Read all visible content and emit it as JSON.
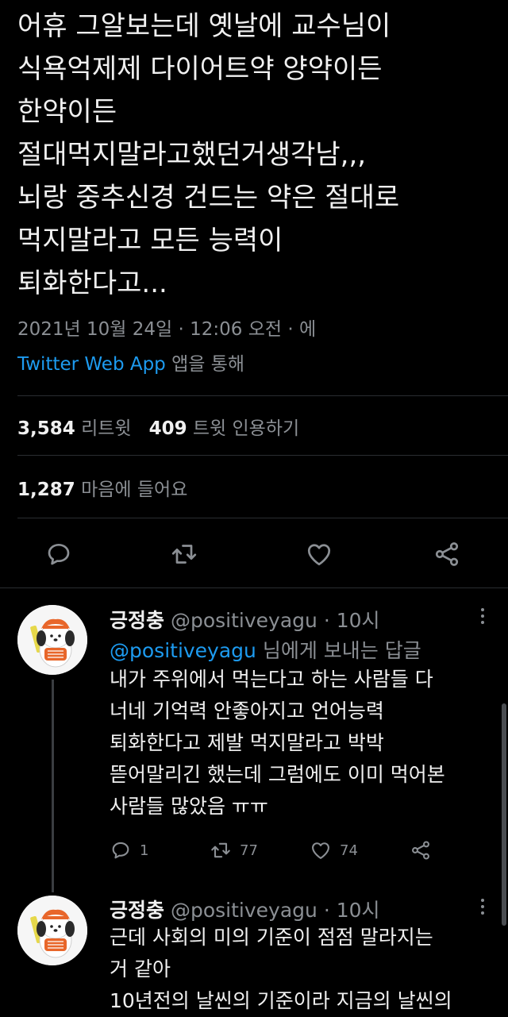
{
  "main_tweet": {
    "text_lines": [
      "어휴 그알보는데 옛날에 교수님이",
      "식욕억제제 다이어트약 양약이든",
      "한약이든",
      "절대먹지말라고했던거생각남,,,",
      "뇌랑 중추신경 건드는 약은 절대로",
      "먹지말라고 모든 능력이",
      "퇴화한다고..."
    ],
    "timestamp": "2021년 10월 24일 · 12:06 오전 · 에",
    "source_app": "Twitter Web App",
    "source_suffix": " 앱을 통해",
    "retweets_count": "3,584",
    "retweets_label": "리트윗",
    "quotes_count": "409",
    "quotes_label": "트윗 인용하기",
    "likes_count": "1,287",
    "likes_label": "마음에 들어요"
  },
  "replies": [
    {
      "name": "긍정충",
      "handle": "@positiveyagu",
      "time": "· 10시",
      "replying_mention": "@positiveyagu",
      "replying_suffix": " 님에게 보내는 답글",
      "text_lines": [
        "내가 주위에서 먹는다고 하는 사람들 다",
        "너네 기억력 안좋아지고 언어능력",
        "퇴화한다고 제발 먹지말라고 박박",
        "뜯어말리긴 했는데 그럼에도 이미 먹어본",
        "사람들 많았음 ㅠㅠ"
      ],
      "reply_count": "1",
      "retweet_count": "77",
      "like_count": "74"
    },
    {
      "name": "긍정충",
      "handle": "@positiveyagu",
      "time": "· 10시",
      "text_lines": [
        "근데 사회의 미의 기준이 점점 말라지는",
        "거 같아",
        "10년전의 날씬의 기준이라 지금의 날씬의"
      ]
    }
  ],
  "colors": {
    "background": "#000000",
    "text": "#f0f0f0",
    "muted": "#8b8f94",
    "link": "#1d9bf0",
    "divider": "#2a2d31"
  },
  "icons": [
    "reply-icon",
    "retweet-icon",
    "like-icon",
    "share-icon",
    "more-icon"
  ]
}
